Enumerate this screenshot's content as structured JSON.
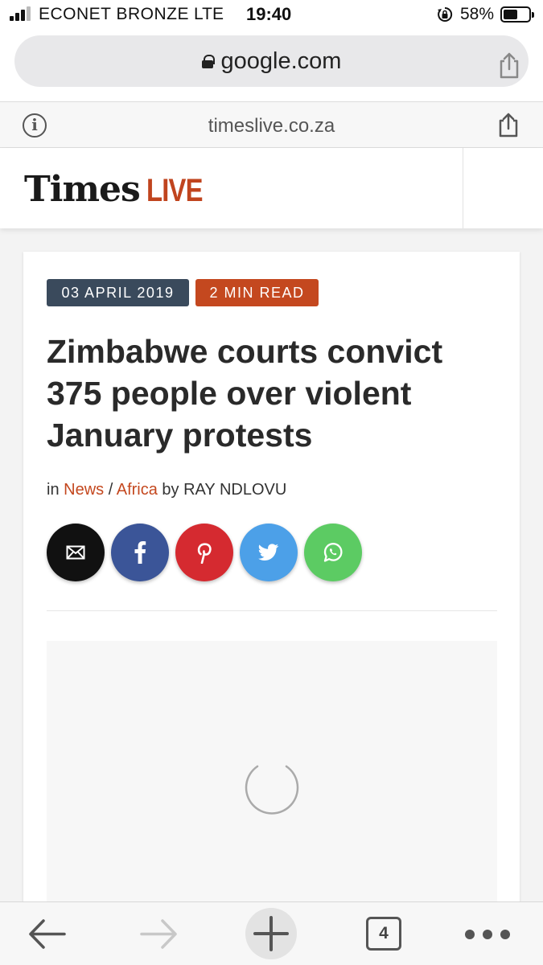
{
  "status_bar": {
    "carrier": "ECONET BRONZE",
    "network": "LTE",
    "time": "19:40",
    "battery_percent": "58%",
    "battery_level": 0.58
  },
  "browser": {
    "url": "google.com"
  },
  "amp_bar": {
    "domain": "timeslive.co.za"
  },
  "site": {
    "logo_times": "Times",
    "logo_live": "LIVE",
    "brand_color": "#c0441e"
  },
  "article": {
    "date_tag": "03 APRIL 2019",
    "read_tag": "2 MIN READ",
    "headline": "Zimbabwe courts convict 375 people over violent January protests",
    "byline": {
      "prefix": "in",
      "section": "News",
      "separator": "/",
      "subsection": "Africa",
      "by": "by",
      "author": "RAY NDLOVU"
    },
    "share_buttons": [
      {
        "network": "email",
        "icon": "email-icon",
        "color": "#111111"
      },
      {
        "network": "facebook",
        "icon": "facebook-icon",
        "color": "#3b5598"
      },
      {
        "network": "pinterest",
        "icon": "pinterest-icon",
        "color": "#d52a30"
      },
      {
        "network": "twitter",
        "icon": "twitter-icon",
        "color": "#4ca0e8"
      },
      {
        "network": "whatsapp",
        "icon": "whatsapp-icon",
        "color": "#5ccb63"
      }
    ]
  },
  "toolbar": {
    "tab_count": "4"
  }
}
